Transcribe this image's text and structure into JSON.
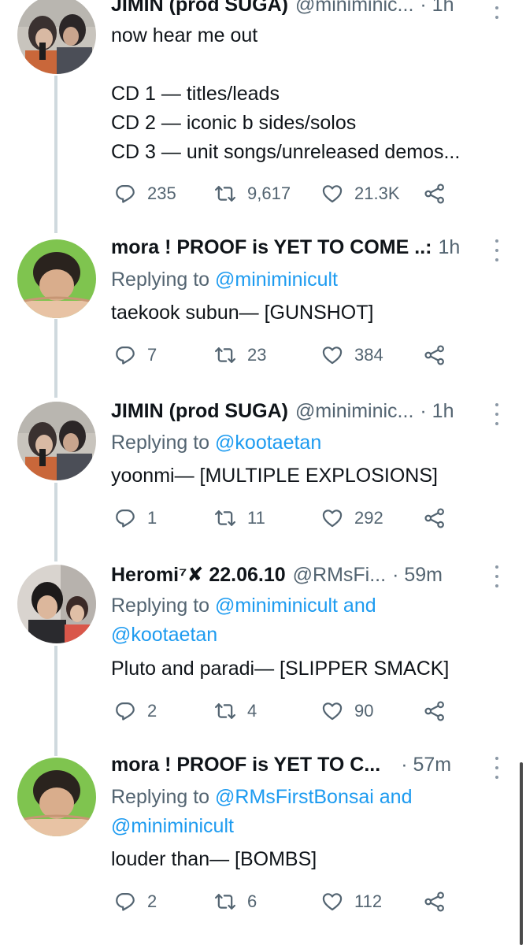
{
  "tweets": [
    {
      "author": "JIMIN (prod SUGA)",
      "handle": "@miniminic...",
      "time": "· 1h",
      "lines": [
        "now hear me out",
        "",
        "CD 1 — titles/leads",
        "CD 2 — iconic b sides/solos",
        "CD 3 — unit songs/unreleased demos..."
      ],
      "replies": "235",
      "retweets": "9,617",
      "likes": "21.3K"
    },
    {
      "author": "mora ! PROOF is YET TO COME ..:",
      "handle": "",
      "time": "1h",
      "replying_label": "Replying to",
      "replying_to": [
        "@miniminicult"
      ],
      "text": "taekook subun— [GUNSHOT]",
      "replies": "7",
      "retweets": "23",
      "likes": "384"
    },
    {
      "author": "JIMIN (prod SUGA)",
      "handle": "@miniminic...",
      "time": "· 1h",
      "replying_label": "Replying to",
      "replying_to": [
        "@kootaetan"
      ],
      "text": "yoonmi— [MULTIPLE EXPLOSIONS]",
      "replies": "1",
      "retweets": "11",
      "likes": "292"
    },
    {
      "author": "Heromi⁷✘ 22.06.10",
      "handle": "@RMsFi...",
      "time": "· 59m",
      "replying_label": "Replying to",
      "replying_to": [
        "@miniminicult and",
        "@kootaetan"
      ],
      "text": "Pluto and paradi— [SLIPPER SMACK]",
      "replies": "2",
      "retweets": "4",
      "likes": "90"
    },
    {
      "author": "mora ! PROOF is YET TO C...",
      "handle": "",
      "time": "· 57m",
      "replying_label": "Replying to",
      "replying_to": [
        "@RMsFirstBonsai and",
        "@miniminicult"
      ],
      "text": "louder than— [BOMBS]",
      "replies": "2",
      "retweets": "6",
      "likes": "112"
    }
  ],
  "icons": {
    "reply": "reply-icon",
    "retweet": "retweet-icon",
    "like": "heart-icon",
    "share": "share-icon",
    "more": "more-icon"
  },
  "colors": {
    "text": "#0f1419",
    "secondary": "#536471",
    "mention": "#1d9bf0",
    "thread_line": "#cfd9de"
  }
}
